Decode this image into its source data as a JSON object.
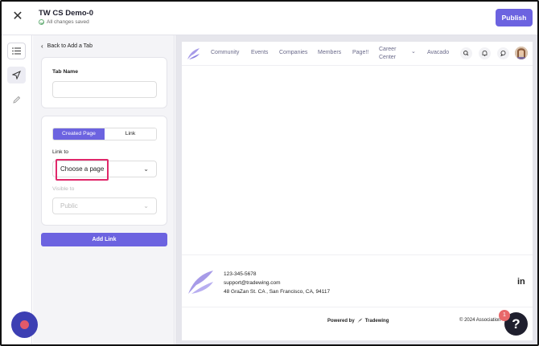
{
  "window": {
    "title": "TW CS Demo-0",
    "status": "All changes saved",
    "publish_label": "Publish"
  },
  "rail": {
    "items": [
      "list-icon",
      "send-icon",
      "pencil-icon"
    ]
  },
  "panel": {
    "back_label": "Back to Add a Tab",
    "tab_name_label": "Tab Name",
    "tab_name_value": "",
    "toggle": {
      "created_page": "Created Page",
      "link": "Link",
      "selected": "Created Page"
    },
    "link_to_label": "Link to",
    "link_to_value": "Choose a page",
    "visible_to_label": "Visible to",
    "visible_to_value": "Public",
    "add_link_label": "Add Link"
  },
  "preview": {
    "nav": {
      "items": [
        "Community",
        "Events",
        "Companies",
        "Members",
        "Page!!",
        "Career Center",
        "Avacado"
      ],
      "career_line1": "Career",
      "career_line2": "Center"
    },
    "footer": {
      "phone": "123-345-5678",
      "email": "support@tradewing.com",
      "address": "48 GraZan St. CA , San Francisco, CA, 94117",
      "powered_by": "Powered by",
      "brand": "Tradewing",
      "copyright": "© 2024 Association",
      "social": "in"
    }
  },
  "floating": {
    "help_label": "?",
    "help_badge": "1"
  },
  "colors": {
    "accent": "#6c63e0",
    "highlight": "#e0286a",
    "logo": "#a79be8"
  }
}
